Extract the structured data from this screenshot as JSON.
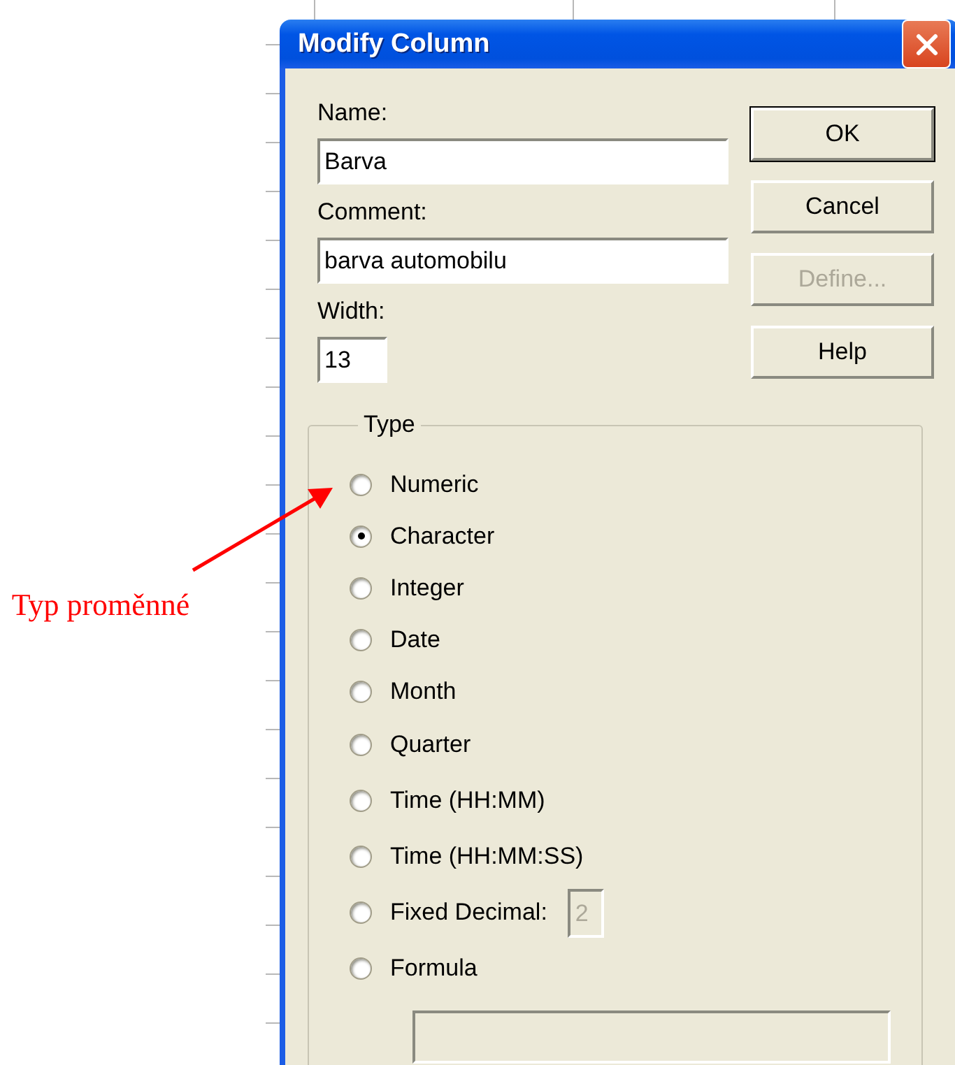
{
  "annotation": {
    "text": "Typ proměnné"
  },
  "window": {
    "title": "Modify Column"
  },
  "fields": [
    {
      "label": "Name:",
      "value": "Barva",
      "kind": "wide"
    },
    {
      "label": "Comment:",
      "value": "barva automobilu",
      "kind": "wide"
    },
    {
      "label": "Width:",
      "value": "13",
      "kind": "narrow"
    }
  ],
  "buttons": [
    {
      "label": "OK",
      "default": true,
      "disabled": false
    },
    {
      "label": "Cancel",
      "default": false,
      "disabled": false
    },
    {
      "label": "Define...",
      "default": false,
      "disabled": true
    },
    {
      "label": "Help",
      "default": false,
      "disabled": false
    }
  ],
  "type_group": {
    "label": "Type",
    "options": [
      {
        "label": "Numeric",
        "selected": false
      },
      {
        "label": "Character",
        "selected": true
      },
      {
        "label": "Integer",
        "selected": false
      },
      {
        "label": "Date",
        "selected": false
      },
      {
        "label": "Month",
        "selected": false
      },
      {
        "label": "Quarter",
        "selected": false
      },
      {
        "label": "Time (HH:MM)",
        "selected": false
      },
      {
        "label": "Time (HH:MM:SS)",
        "selected": false
      },
      {
        "label": "Fixed Decimal:",
        "selected": false,
        "decimals": {
          "value": "2",
          "disabled": true
        }
      },
      {
        "label": "Formula",
        "selected": false
      }
    ],
    "formula_field": {
      "disabled": true
    }
  }
}
